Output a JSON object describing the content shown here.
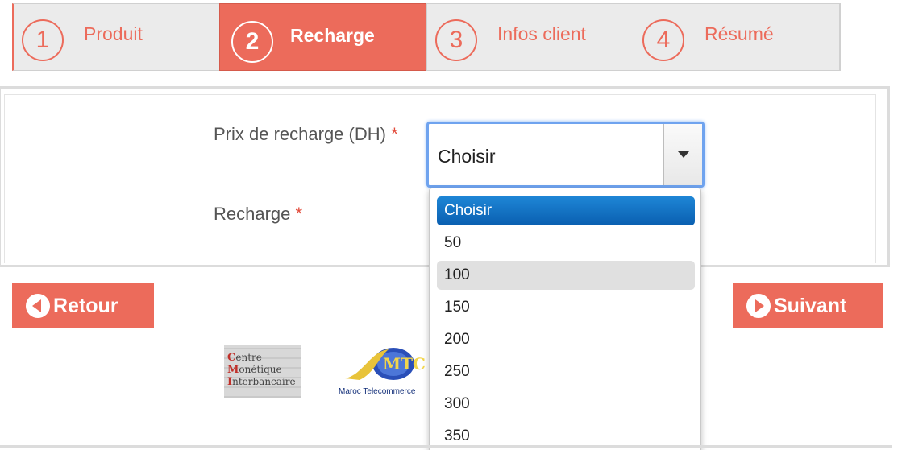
{
  "steps": [
    {
      "number": "1",
      "label": "Produit",
      "active": false
    },
    {
      "number": "2",
      "label": "Recharge",
      "active": true
    },
    {
      "number": "3",
      "label": "Infos client",
      "active": false
    },
    {
      "number": "4",
      "label": "Résumé",
      "active": false
    }
  ],
  "form": {
    "price_label": "Prix de recharge (DH)",
    "recharge_label": "Recharge",
    "required_mark": "*",
    "price_select": {
      "value": "Choisir",
      "options": [
        "Choisir",
        "50",
        "100",
        "150",
        "200",
        "250",
        "300",
        "350"
      ],
      "selected_index": 0,
      "hovered_index": 2
    }
  },
  "nav": {
    "back_label": "Retour",
    "next_label": "Suivant"
  },
  "logos": {
    "cmi_lines": [
      "Centre",
      "Monétique",
      "Interbancaire"
    ],
    "mt_caption": "Maroc Telecommerce",
    "mt_mark": "MTC"
  },
  "colors": {
    "accent": "#ec6b5b",
    "focus": "#6fa3ef",
    "option_selected": "#0a5fb0",
    "required": "#e24b3b"
  }
}
